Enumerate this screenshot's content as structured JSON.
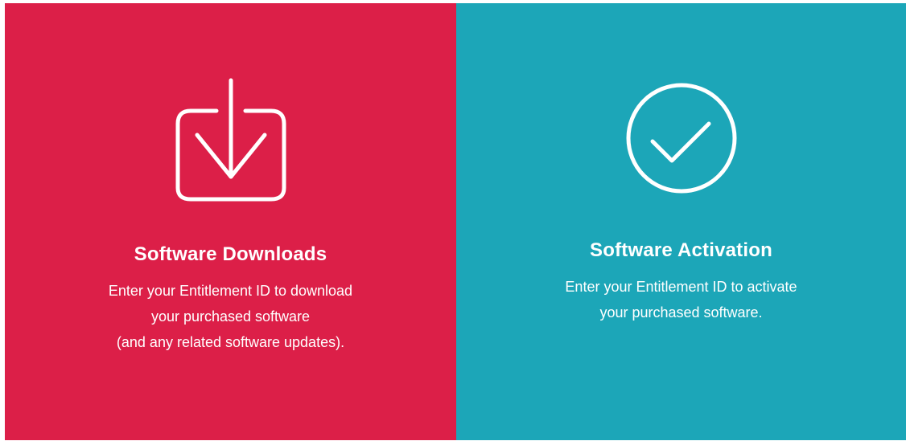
{
  "colors": {
    "downloads_bg": "#dc1f48",
    "activation_bg": "#1ca6b8",
    "foreground": "#ffffff"
  },
  "panels": {
    "downloads": {
      "icon": "download-tray-icon",
      "title": "Software Downloads",
      "description_lines": [
        "Enter your Entitlement ID to download",
        "your purchased software",
        "(and any related software updates)."
      ]
    },
    "activation": {
      "icon": "checkmark-circle-icon",
      "title": "Software Activation",
      "description_lines": [
        "Enter your Entitlement ID to activate",
        "your purchased software."
      ]
    }
  }
}
